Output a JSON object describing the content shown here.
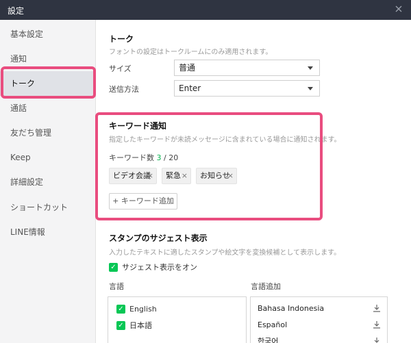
{
  "window": {
    "title": "設定"
  },
  "sidebar": {
    "items": [
      {
        "label": "基本設定"
      },
      {
        "label": "通知"
      },
      {
        "label": "トーク"
      },
      {
        "label": "通話"
      },
      {
        "label": "友だち管理"
      },
      {
        "label": "Keep"
      },
      {
        "label": "詳細設定"
      },
      {
        "label": "ショートカット"
      },
      {
        "label": "LINE情報"
      }
    ],
    "active_index": 2
  },
  "talk": {
    "title": "トーク",
    "desc": "フォントの設定はトークルームにのみ適用されます。",
    "size_label": "サイズ",
    "size_value": "普通",
    "send_label": "送信方法",
    "send_value": "Enter"
  },
  "keyword": {
    "title": "キーワード通知",
    "desc": "指定したキーワードが未読メッセージに含まれている場合に通知されます。",
    "count_label": "キーワード数",
    "count_current": "3",
    "count_total": "/ 20",
    "tags": [
      "ビデオ会議",
      "緊急",
      "お知らせ"
    ],
    "add_label": "+ キーワード追加"
  },
  "sticker": {
    "title": "スタンプのサジェスト表示",
    "desc": "入力したテキストに適したスタンプや絵文字を変換候補として表示します。",
    "toggle_label": "サジェスト表示をオン",
    "lang_label": "言語",
    "lang_add_label": "言語追加",
    "languages": [
      "English",
      "日本語"
    ],
    "available": [
      "Bahasa Indonesia",
      "Español",
      "한국어"
    ]
  },
  "colors": {
    "accent": "#06c755",
    "highlight": "#e94d7f",
    "titlebar": "#2f3441"
  }
}
